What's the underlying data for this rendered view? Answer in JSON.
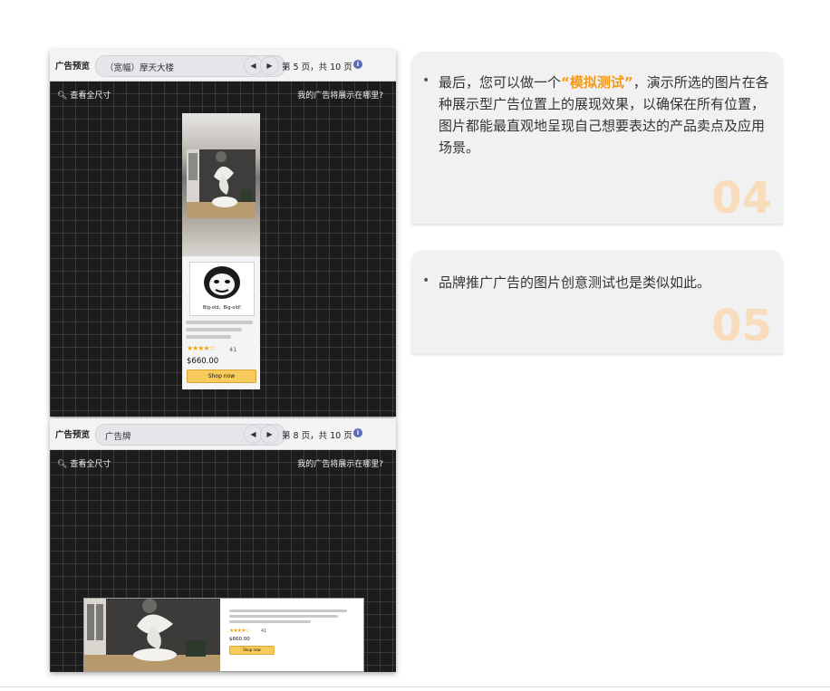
{
  "panel1": {
    "bar_label": "广告预览",
    "select_value": "（宽幅）摩天大楼",
    "page_info": "第 5 页，共 10 页",
    "view_all": "查看全尺寸",
    "where_shown": "我的广告将展示在哪里?",
    "ad": {
      "meme_caption": "Big-old，Big-old!",
      "rating_count": "41",
      "price": "$660.00",
      "button": "Shop now"
    }
  },
  "panel2": {
    "bar_label": "广告预览",
    "select_value": "广告牌",
    "page_info": "第 8 页，共 10 页",
    "view_all": "查看全尺寸",
    "where_shown": "我的广告将展示在哪里?",
    "ad": {
      "rating_count": "41",
      "price": "$660.00",
      "button": "Shop now"
    }
  },
  "card1": {
    "text_before": "最后，您可以做一个",
    "highlight": "“模拟测试”",
    "text_after": "，演示所选的图片在各种展示型广告位置上的展现效果，以确保在所有位置，图片都能最直观地呈现自己想要表达的产品卖点及应用场景。",
    "number": "04"
  },
  "card2": {
    "text": "品牌推广广告的图片创意测试也是类似如此。",
    "number": "05"
  },
  "colors": {
    "accent_orange": "#f59a17",
    "number_color": "#f8dcbc",
    "shop_button": "#f7ca5b"
  }
}
